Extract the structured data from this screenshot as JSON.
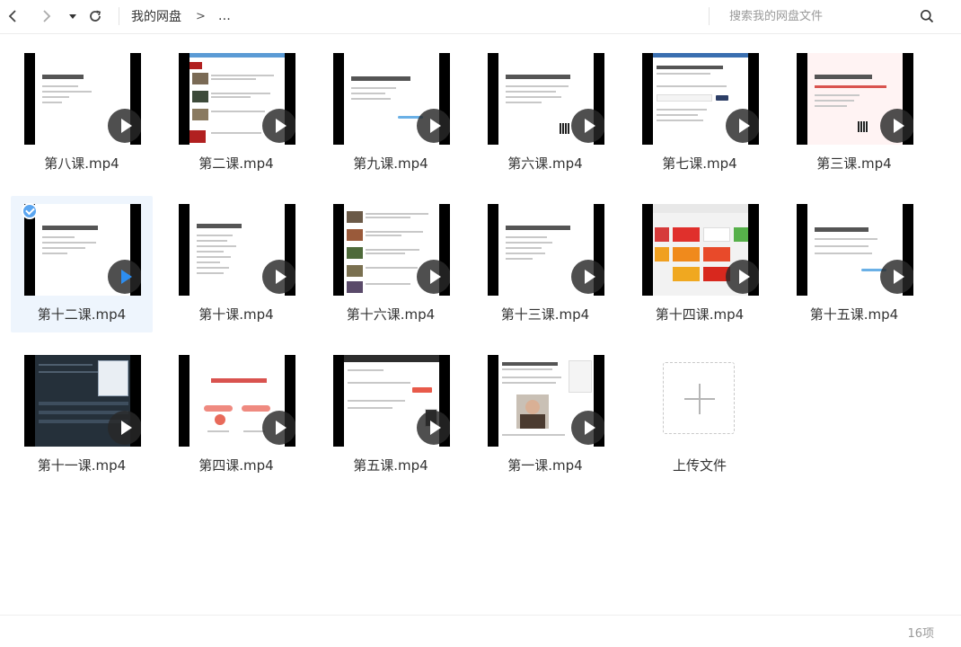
{
  "toolbar": {
    "breadcrumbs": [
      "我的网盘",
      "…"
    ],
    "breadcrumb_separator": ">",
    "search_placeholder": "搜索我的网盘文件",
    "icons": {
      "back": "chevron-left-icon",
      "forward": "chevron-right-icon",
      "history": "caret-down-icon",
      "refresh": "refresh-icon",
      "search": "search-icon"
    }
  },
  "files": [
    {
      "name": "第八课.mp4",
      "thumb_title": "Vlog视频拍摄技巧",
      "selected": false
    },
    {
      "name": "第二课.mp4",
      "thumb_title": "",
      "selected": false
    },
    {
      "name": "第九课.mp4",
      "thumb_title": "剪辑通用技巧",
      "selected": false
    },
    {
      "name": "第六课.mp4",
      "thumb_title": "封面设计技巧提升100%",
      "selected": false
    },
    {
      "name": "第七课.mp4",
      "thumb_title": "",
      "selected": false
    },
    {
      "name": "第三课.mp4",
      "thumb_title": "头条号流量分析方法",
      "selected": false
    },
    {
      "name": "第十二课.mp4",
      "thumb_title": "视频剪辑软件推荐",
      "selected": true
    },
    {
      "name": "第十课.mp4",
      "thumb_title": "必须遵循的规范",
      "selected": false
    },
    {
      "name": "第十六课.mp4",
      "thumb_title": "",
      "selected": false
    },
    {
      "name": "第十三课.mp4",
      "thumb_title": "一个视频标10万流量",
      "selected": false
    },
    {
      "name": "第十四课.mp4",
      "thumb_title": "",
      "selected": false
    },
    {
      "name": "第十五课.mp4",
      "thumb_title": "头条号月入10万秘诀",
      "selected": false
    },
    {
      "name": "第十一课.mp4",
      "thumb_title": "",
      "selected": false
    },
    {
      "name": "第四课.mp4",
      "thumb_title": "头条视频上传变现",
      "selected": false
    },
    {
      "name": "第五课.mp4",
      "thumb_title": "",
      "selected": false
    },
    {
      "name": "第一课.mp4",
      "thumb_title": "",
      "selected": false
    }
  ],
  "upload_tile": {
    "label": "上传文件",
    "icon": "plus-icon"
  },
  "status": {
    "item_count": "16项"
  },
  "colors": {
    "accent": "#2e8ef0",
    "selection": "#eef5fd",
    "thumb_header": "#5b9bd5"
  }
}
